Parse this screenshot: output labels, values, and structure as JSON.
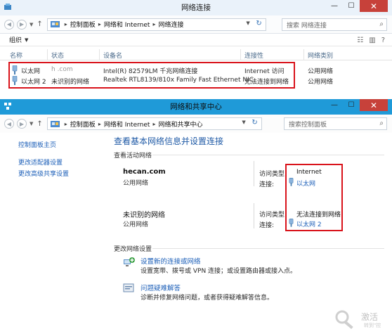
{
  "window1": {
    "title": "网络连接",
    "breadcrumb": [
      "控制面板",
      "网络和 Internet",
      "网络连接"
    ],
    "search_placeholder": "搜索 网络连接",
    "organize_label": "组织",
    "columns": [
      "名称",
      "状态",
      "设备名",
      "连接性",
      "网络类别"
    ],
    "rows": [
      {
        "name": "以太网",
        "status": "h  .com",
        "device": "Intel(R) 82579LM 千兆网络连接",
        "connectivity": "Internet 访问",
        "category": "公用网络"
      },
      {
        "name": "以太网 2",
        "status": "未识别的网络",
        "device": "Realtek RTL8139/810x Family Fast Ethernet NIC",
        "connectivity": "无法连接到网络",
        "category": "公用网络"
      }
    ]
  },
  "window2": {
    "title": "网络和共享中心",
    "breadcrumb": [
      "控制面板",
      "网络和 Internet",
      "网络和共享中心"
    ],
    "search_placeholder": "搜索控制面板",
    "sidebar": [
      "控制面板主页",
      "更改适配器设置",
      "更改高级共享设置"
    ],
    "main_title": "查看基本网络信息并设置连接",
    "active_networks_label": "查看活动网络",
    "networks": [
      {
        "name": "hecan.com",
        "type": "公用网络",
        "access_label": "访问类型:",
        "access_value": "Internet",
        "conn_label": "连接:",
        "conn_value": "以太网"
      },
      {
        "name": "未识别的网络",
        "type": "公用网络",
        "access_label": "访问类型:",
        "access_value": "无法连接到网络",
        "conn_label": "连接:",
        "conn_value": "以太网 2"
      }
    ],
    "change_settings_label": "更改网络设置",
    "tasks": [
      {
        "link": "设置新的连接或网络",
        "desc": "设置宽带、拨号或 VPN 连接；或设置路由器或接入点。"
      },
      {
        "link": "问题疑难解答",
        "desc": "诊断并修复网络问题，或者获得疑难解答信息。"
      }
    ]
  },
  "watermark": {
    "main": "激活",
    "sub": "转到\"控"
  },
  "colors": {
    "highlight": "#d9131b",
    "link": "#1c5fb8",
    "titlebar_active": "#1f9ad8",
    "close": "#c7413a"
  }
}
